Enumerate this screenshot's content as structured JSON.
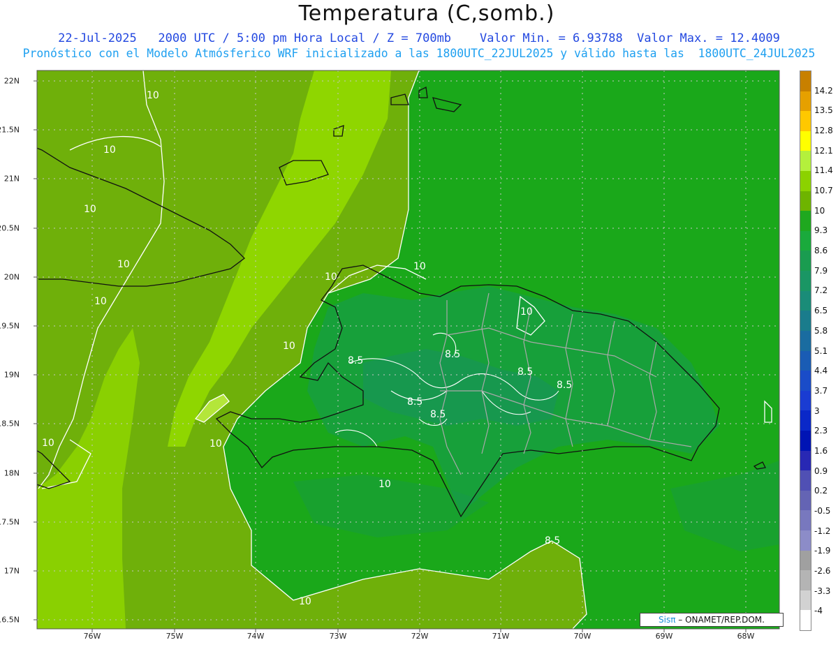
{
  "header": {
    "title": "Temperatura (C,somb.)",
    "line1": "22-Jul-2025   2000 UTC / 5:00 pm Hora Local / Z = 700mb    Valor Min. = 6.93788  Valor Max. = 12.4009",
    "line2": "Pronóstico con el Modelo Atmósferico WRF inicializado a las 1800UTC_22JUL2025 y válido hasta las  1800UTC_24JUL2025"
  },
  "map": {
    "lat_labels": [
      "22N",
      "21.5N",
      "21N",
      "20.5N",
      "20N",
      "19.5N",
      "19N",
      "18.5N",
      "18N",
      "17.5N",
      "17N",
      "16.5N"
    ],
    "lon_labels": [
      "76W",
      "75W",
      "74W",
      "73W",
      "72W",
      "71W",
      "70W",
      "69W",
      "68W"
    ],
    "contour_labels": [
      "10",
      "10",
      "10",
      "10",
      "10",
      "10",
      "10",
      "10",
      "10",
      "10",
      "10",
      "10",
      "10",
      "8.5",
      "8.5",
      "8.5",
      "8.5",
      "8.5",
      "8.5",
      "8.5"
    ],
    "fill_colors": {
      "base": "#1aa81a",
      "warm": "#6fb00a",
      "warmer": "#8fd600",
      "warmest": "#b4e63a",
      "cool": "#17a03a",
      "cooler": "#189656"
    }
  },
  "colorbar": {
    "labels": [
      "14.2",
      "13.5",
      "12.8",
      "12.1",
      "11.4",
      "10.7",
      "10",
      "9.3",
      "8.6",
      "7.9",
      "7.2",
      "6.5",
      "5.8",
      "5.1",
      "4.4",
      "3.7",
      "3",
      "2.3",
      "1.6",
      "0.9",
      "0.2",
      "-0.5",
      "-1.2",
      "-1.9",
      "-2.6",
      "-3.3",
      "-4"
    ],
    "colors": [
      "#c88000",
      "#e6a000",
      "#ffc800",
      "#ffff00",
      "#b4f03c",
      "#8cd200",
      "#6eb400",
      "#1fa81f",
      "#1aaa3c",
      "#1a9c50",
      "#1a9664",
      "#1a8c78",
      "#1a7c8c",
      "#1a6ca0",
      "#1a5cb4",
      "#1a4cc8",
      "#1a3cd2",
      "#0a28c8",
      "#0014b4",
      "#2828b4",
      "#5050b4",
      "#6464b4",
      "#7878be",
      "#8c8cc8",
      "#a0a0a0",
      "#b4b4b4",
      "#d2d2d2",
      "#ffffff"
    ]
  },
  "credit": {
    "brand": "Sisπ",
    "text": "– ONAMET/REP.DOM."
  }
}
